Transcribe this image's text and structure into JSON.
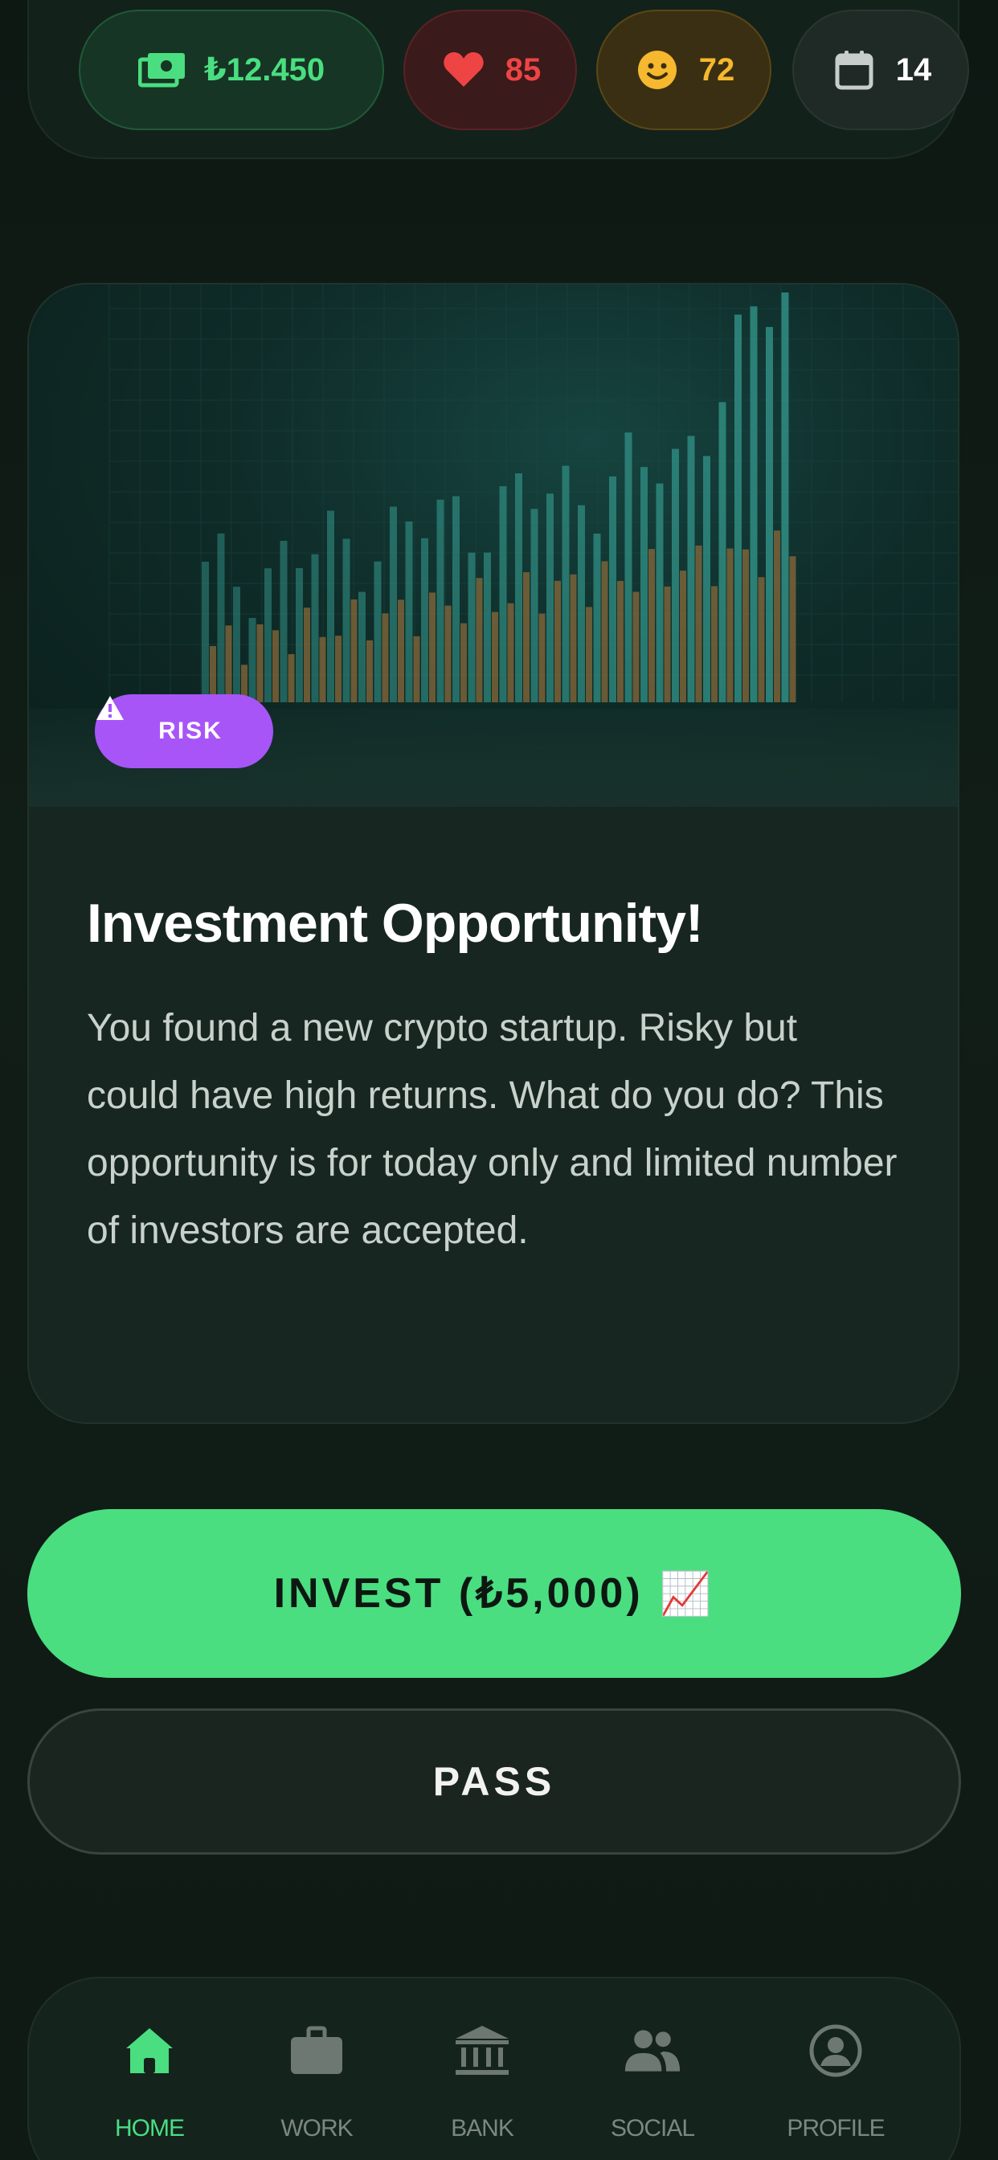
{
  "stats": {
    "money": "₺12.450",
    "health": "85",
    "happiness": "72",
    "day": "14"
  },
  "event": {
    "badge": "RISK",
    "title": "Investment Opportunity!",
    "description": "You found a new crypto startup. Risky but could have high returns. What do you do? This opportunity is for today only and limited number of investors are accepted."
  },
  "actions": {
    "invest_label": "INVEST (₺5,000)",
    "invest_emoji": "📈",
    "pass_label": "PASS"
  },
  "nav": {
    "items": [
      {
        "label": "HOME",
        "icon": "home-icon",
        "active": true
      },
      {
        "label": "WORK",
        "icon": "briefcase-icon",
        "active": false
      },
      {
        "label": "BANK",
        "icon": "bank-icon",
        "active": false
      },
      {
        "label": "SOCIAL",
        "icon": "people-icon",
        "active": false
      },
      {
        "label": "PROFILE",
        "icon": "profile-icon",
        "active": false
      }
    ]
  },
  "colors": {
    "accent": "#4ade80",
    "health": "#ef4444",
    "happiness": "#f5b82e",
    "risk": "#a855f7",
    "background": "#0f1a15"
  }
}
